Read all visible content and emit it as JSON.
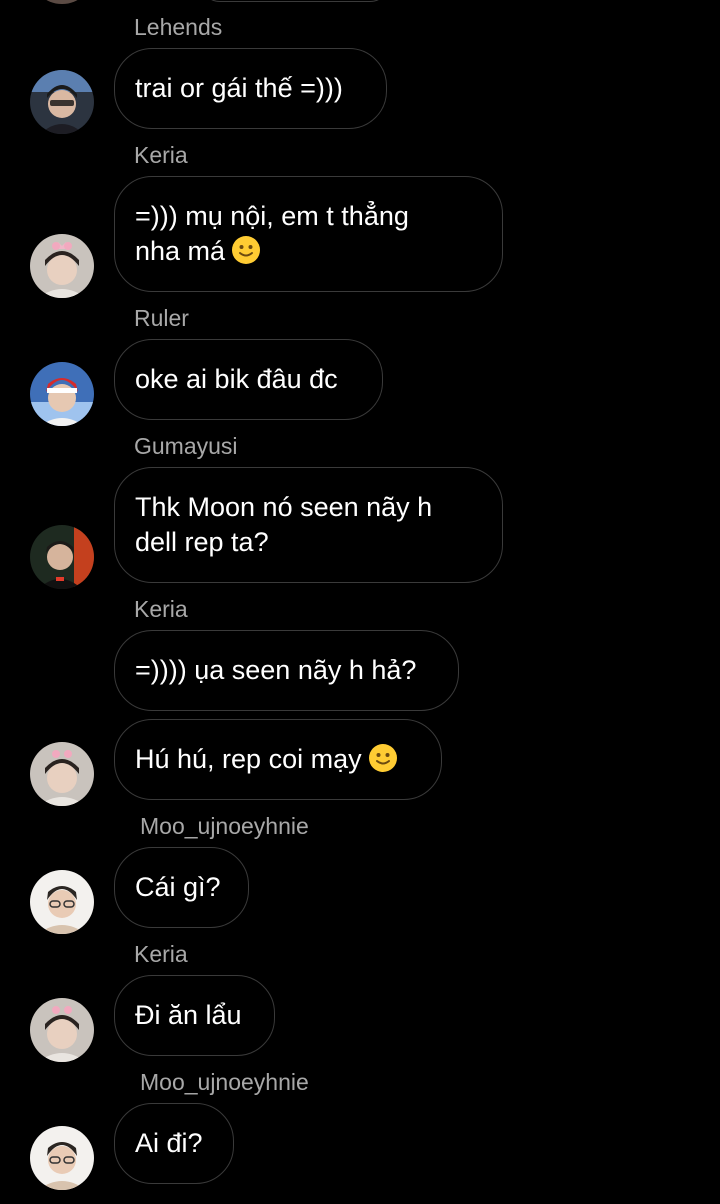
{
  "chat": {
    "messages": [
      {
        "sender": "Lehends",
        "text": "trai or gái thế =)))"
      },
      {
        "sender": "Keria",
        "line1": "=))) mụ nội, em t thẳng",
        "line2": "nha má"
      },
      {
        "sender": "Ruler",
        "text": "oke ai bik đâu đc"
      },
      {
        "sender": "Gumayusi",
        "line1": "Thk Moon nó seen nãy h",
        "line2": "dell rep ta?"
      },
      {
        "sender": "Keria",
        "text": "=)))) ụa seen nãy h hả?"
      },
      {
        "text": "Hú hú, rep coi mạy"
      },
      {
        "sender": "Moo_ujnoeyhnie",
        "text": "Cái gì?"
      },
      {
        "sender": "Keria",
        "text": "Đi ăn lẩu"
      },
      {
        "sender": "Moo_ujnoeyhnie",
        "text": "Ai đi?"
      }
    ]
  },
  "icons": {
    "smile_emoji": "slightly-smiling-face-icon"
  },
  "colors": {
    "background": "#000000",
    "bubble_border": "#3a3a3a",
    "sender_name": "#a8a8a8",
    "message_text": "#ffffff",
    "emoji": "#ffcc33"
  }
}
